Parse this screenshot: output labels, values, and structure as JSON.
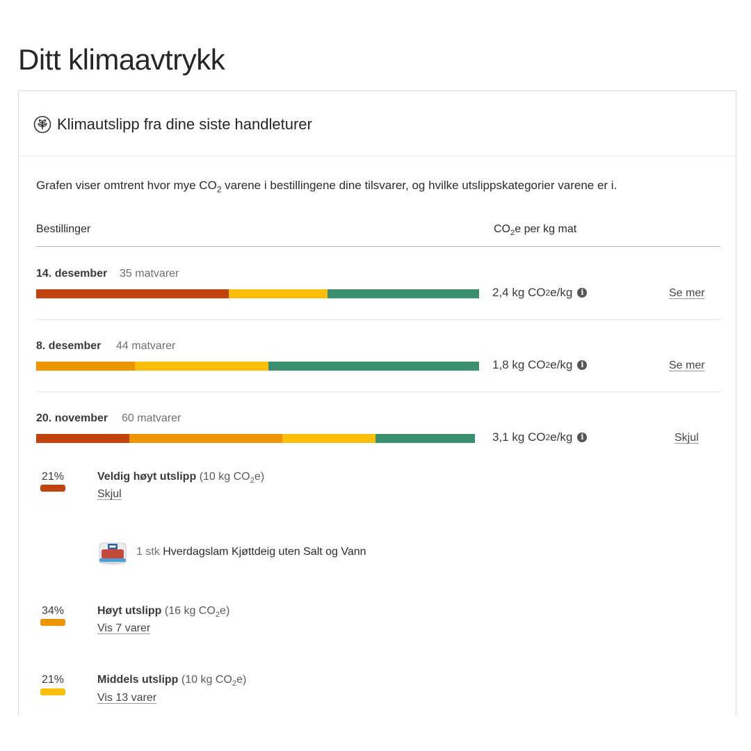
{
  "page_title": "Ditt klimaavtrykk",
  "card": {
    "title": "Klimautslipp fra dine siste handleturer",
    "intro_before": "Grafen viser omtrent hvor mye CO",
    "intro_sub": "2",
    "intro_after": " varene i bestillingene dine tilsvarer, og hvilke utslippskategorier varene er i.",
    "col_orders": "Bestillinger",
    "col_co2_a": "CO",
    "col_co2_sub": "2",
    "col_co2_b": "e per kg mat"
  },
  "colors": {
    "very_high": "#c1440e",
    "high": "#ec9500",
    "medium": "#fbbf0a",
    "low": "#3a8f6e"
  },
  "orders": [
    {
      "date": "14. desember",
      "count": "35 matvarer",
      "co2_value": "2,4 kg CO",
      "co2_unit": "e/kg",
      "action": "Se mer",
      "segments_fraction": [
        {
          "category": "very_high",
          "share": 0.435
        },
        {
          "category": "medium",
          "share": 0.222
        },
        {
          "category": "low",
          "share": 0.343
        }
      ]
    },
    {
      "date": "8. desember",
      "count": "44 matvarer",
      "co2_value": "1,8 kg CO",
      "co2_unit": "e/kg",
      "action": "Se mer",
      "segments_fraction": [
        {
          "category": "high",
          "share": 0.223
        },
        {
          "category": "medium",
          "share": 0.302
        },
        {
          "category": "low",
          "share": 0.475
        }
      ]
    },
    {
      "date": "20. november",
      "count": "60 matvarer",
      "co2_value": "3,1 kg CO",
      "co2_unit": "e/kg",
      "action": "Skjul",
      "segments_fraction": [
        {
          "category": "very_high",
          "share": 0.213
        },
        {
          "category": "high",
          "share": 0.348
        },
        {
          "category": "medium",
          "share": 0.213
        },
        {
          "category": "low",
          "share": 0.226
        }
      ]
    }
  ],
  "categories": [
    {
      "percent": "21%",
      "name": "Veldig høyt utslipp",
      "amount_a": "(10 kg CO",
      "amount_b": "e)",
      "link": "Skjul",
      "color_key": "very_high"
    },
    {
      "percent": "34%",
      "name": "Høyt utslipp",
      "amount_a": "(16 kg CO",
      "amount_b": "e)",
      "link": "Vis 7 varer",
      "color_key": "high"
    },
    {
      "percent": "21%",
      "name": "Middels utslipp",
      "amount_a": "(10 kg CO",
      "amount_b": "e)",
      "link": "Vis 13 varer",
      "color_key": "medium"
    }
  ],
  "expanded_product": {
    "quantity": "1 stk",
    "name": "Hverdagslam Kjøttdeig uten Salt og Vann"
  }
}
